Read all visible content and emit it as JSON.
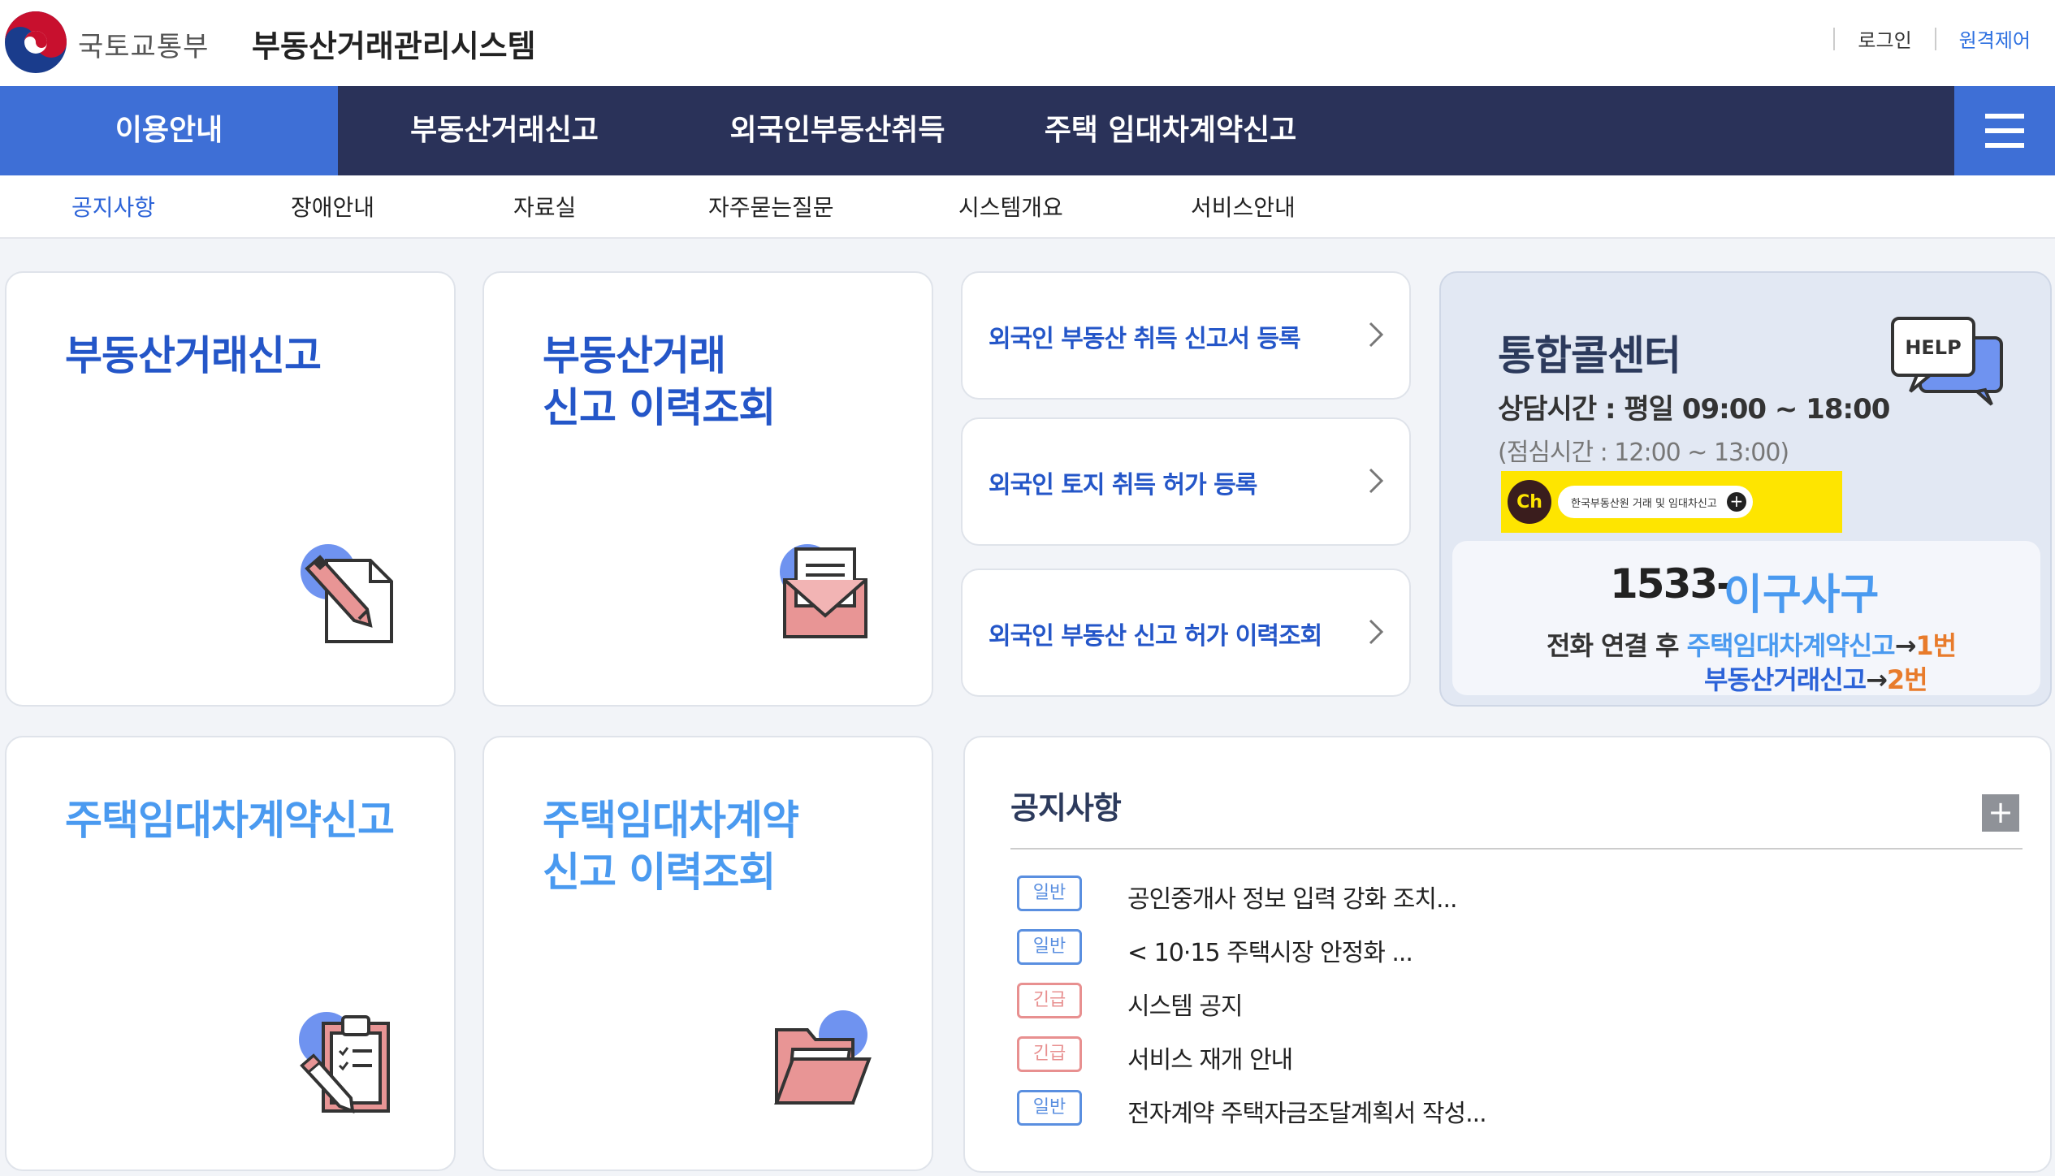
{
  "header": {
    "ministry": "국토교통부",
    "system_title": "부동산거래관리시스템",
    "login": "로그인",
    "remote": "원격제어"
  },
  "main_nav": [
    {
      "label": "이용안내",
      "active": true
    },
    {
      "label": "부동산거래신고",
      "active": false
    },
    {
      "label": "외국인부동산취득",
      "active": false
    },
    {
      "label": "주택 임대차계약신고",
      "active": false
    }
  ],
  "menu_icon": "hamburger-menu-icon",
  "sub_nav": [
    {
      "label": "공지사항",
      "active": true
    },
    {
      "label": "장애안내",
      "active": false
    },
    {
      "label": "자료실",
      "active": false
    },
    {
      "label": "자주묻는질문",
      "active": false
    },
    {
      "label": "시스템개요",
      "active": false
    },
    {
      "label": "서비스안내",
      "active": false
    }
  ],
  "cards": {
    "trade_report": {
      "line1": "부동산거래신고",
      "icon": "pencil-document-icon"
    },
    "trade_history": {
      "line1": "부동산거래",
      "line2": "신고 이력조회",
      "icon": "envelope-icon"
    },
    "lease_report": {
      "line1": "주택임대차계약신고",
      "icon": "clipboard-checklist-icon"
    },
    "lease_history": {
      "line1": "주택임대차계약",
      "line2": "신고 이력조회",
      "icon": "folder-icon"
    }
  },
  "foreign_links": [
    "외국인 부동산 취득 신고서 등록",
    "외국인 토지 취득 허가 등록",
    "외국인 부동산 신고 허가 이력조회"
  ],
  "call_center": {
    "title": "통합콜센터",
    "hours": "상담시간 : 평일 09:00 ~ 18:00",
    "lunch": "(점심시간 : 12:00 ~ 13:00)",
    "kakao_ch": "Ch",
    "kakao_label": "한국부동산원 거래 및 임대차신고",
    "help_label": "HELP",
    "phone_prefix": "1533-",
    "phone_suffix": "이구사구",
    "line1_prefix": "전화 연결 후",
    "line1_target": "주택임대차계약신고",
    "line1_arrow": "→",
    "line1_num": "1번",
    "line2_target": "부동산거래신고",
    "line2_arrow": "→",
    "line2_num": "2번"
  },
  "notices": {
    "title": "공지사항",
    "more": "+",
    "items": [
      {
        "badge": "일반",
        "type": "normal",
        "text": "공인중개사 정보 입력 강화 조치..."
      },
      {
        "badge": "일반",
        "type": "normal",
        "text": "< 10·15 주택시장 안정화 ..."
      },
      {
        "badge": "긴급",
        "type": "urgent",
        "text": "시스템 공지"
      },
      {
        "badge": "긴급",
        "type": "urgent",
        "text": "서비스 재개 안내"
      },
      {
        "badge": "일반",
        "type": "normal",
        "text": "전자계약 주택자금조달계획서 작성..."
      }
    ]
  },
  "colors": {
    "nav_bg": "#2a3259",
    "nav_active": "#3e6fd6",
    "title_blue": "#2456c8",
    "light_blue": "#4a9af0",
    "orange": "#e87b2b",
    "kakao_yellow": "#fee500"
  }
}
